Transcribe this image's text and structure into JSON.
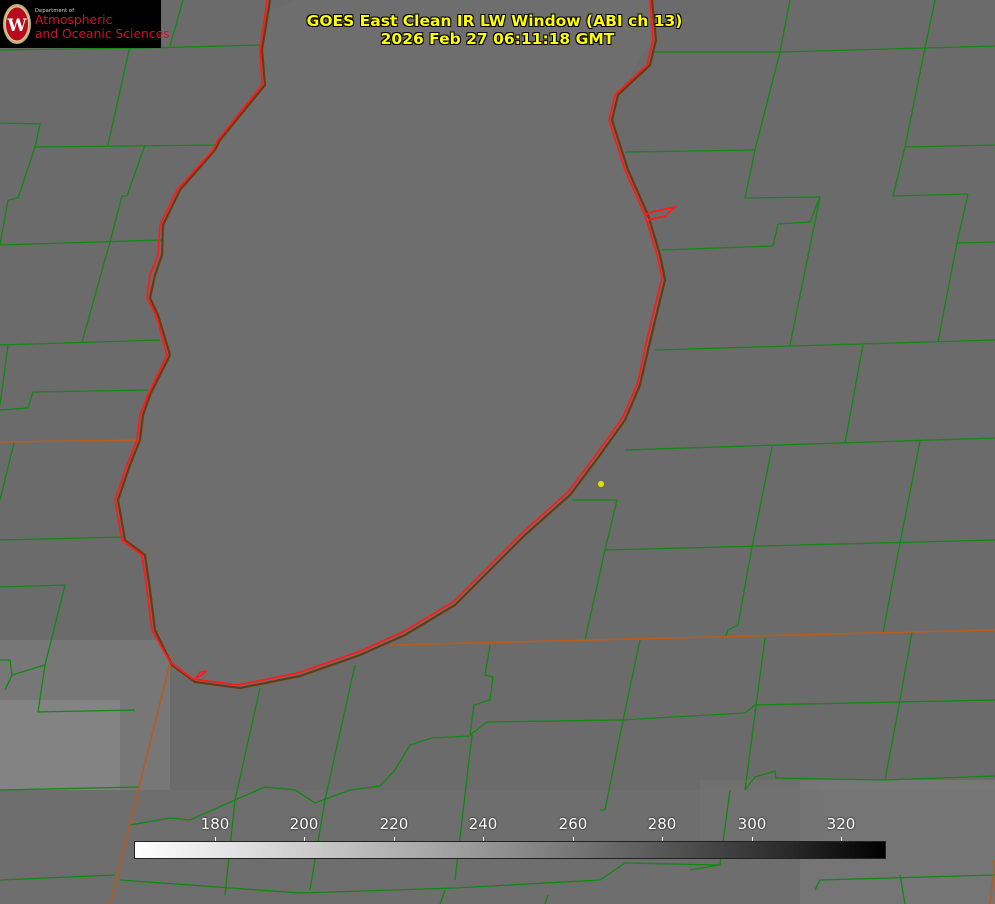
{
  "title": {
    "line1": "GOES East Clean IR LW Window (ABI ch 13)",
    "line2": "2026 Feb 27 06:11:18 GMT"
  },
  "logo": {
    "department": "Department of",
    "name_line1": "Atmospheric",
    "name_line2": "and Oceanic Sciences",
    "seal_letter": "W"
  },
  "colorbar": {
    "ticks": [
      "180",
      "200",
      "220",
      "240",
      "260",
      "280",
      "300",
      "320"
    ],
    "gradient_start": "#ffffff",
    "gradient_end": "#000000"
  },
  "colors": {
    "background": "#6b6b6b",
    "lake_fill": "#6f6f6f",
    "county_lines": "#118811",
    "coastline": "#ff1a1a",
    "state_border": "#b85b1a",
    "marker": "#e3e000",
    "title_text": "#ffff00"
  }
}
